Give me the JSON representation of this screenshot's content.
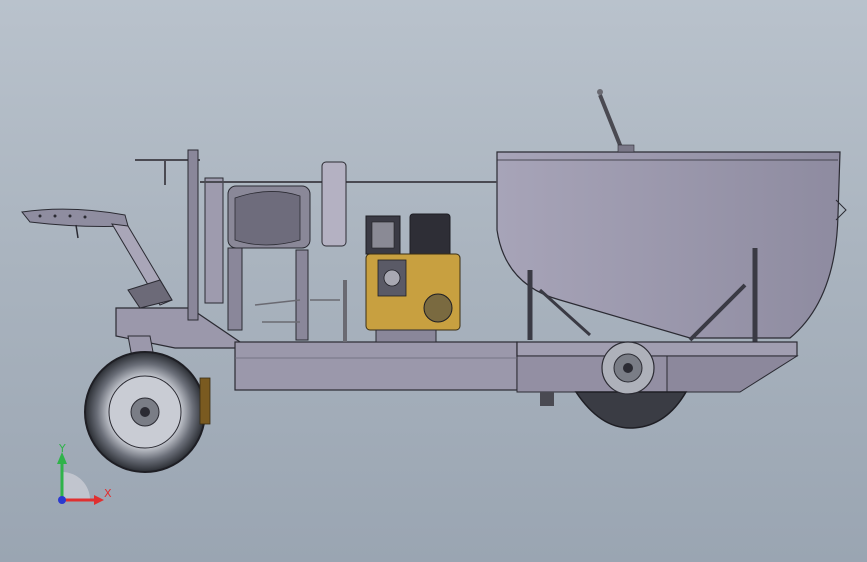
{
  "viewport": {
    "background_top": "#b9c2cc",
    "background_bottom": "#9aa5b2"
  },
  "triad": {
    "x_label": "X",
    "y_label": "Y",
    "x_color": "#e03030",
    "y_color": "#2fb34a",
    "z_color": "#2a3ad0"
  },
  "model": {
    "body_color": "#9b98ab",
    "edge_color": "#2b2b33",
    "engine_accent": "#c8a040"
  }
}
